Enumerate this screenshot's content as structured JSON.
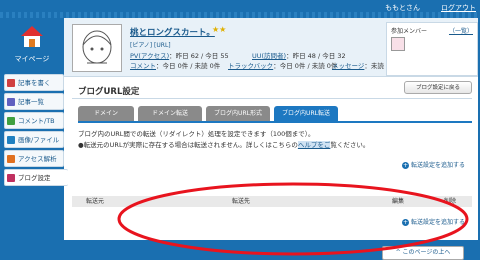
{
  "header": {
    "user": "ももとさん",
    "logout": "ログアウト"
  },
  "mypage": {
    "label": "マイページ"
  },
  "sidebar": {
    "items": [
      {
        "label": "記事を書く",
        "color": "#d04040"
      },
      {
        "label": "記事一覧",
        "color": "#6060c0"
      },
      {
        "label": "コメント/TB",
        "color": "#40a040"
      },
      {
        "label": "画像/ファイル",
        "color": "#2080c0"
      },
      {
        "label": "アクセス解析",
        "color": "#e07020"
      },
      {
        "label": "ブログ設定",
        "color": "#c03060"
      }
    ]
  },
  "profile": {
    "title": "桃とロングスカート。",
    "stars": "★★",
    "sub": "[ピアノ] [URL]",
    "pv_label": "PV(アクセス)",
    "pv_value": "：昨日 62 / 今日 55",
    "uu_label": "UU(訪問者)",
    "uu_value": "：昨日 48 / 今日 32",
    "comment_label": "コメント",
    "comment_value": "：今日 0件 / 未読 0件",
    "tb_label": "トラックバック",
    "tb_value": "：今日 0件 / 未読 0件",
    "msg_label": "メッセージ",
    "msg_value": "：未読 0件",
    "members_title": "参加メンバー",
    "members_list": "（一覧）"
  },
  "page": {
    "title": "ブログURL設定",
    "back_button": "ブログ設定に戻る",
    "tabs": [
      "ドメイン",
      "ドメイン転送",
      "ブログ内URL形式",
      "ブログ内URL転送"
    ],
    "desc1": "ブログ内のURL間での転送（リダイレクト）処理を設定できます（100個まで）。",
    "desc2_pre": "●転送元のURLが実際に存在する場合は転送されません。詳しくはこちらの",
    "desc2_link": "ヘルプをご",
    "desc2_post": "覧ください。",
    "add_link": "転送設定を追加する",
    "table_headers": [
      "転送元",
      "転送先",
      "編集",
      "削除"
    ],
    "page_top": "このページの上へ"
  }
}
